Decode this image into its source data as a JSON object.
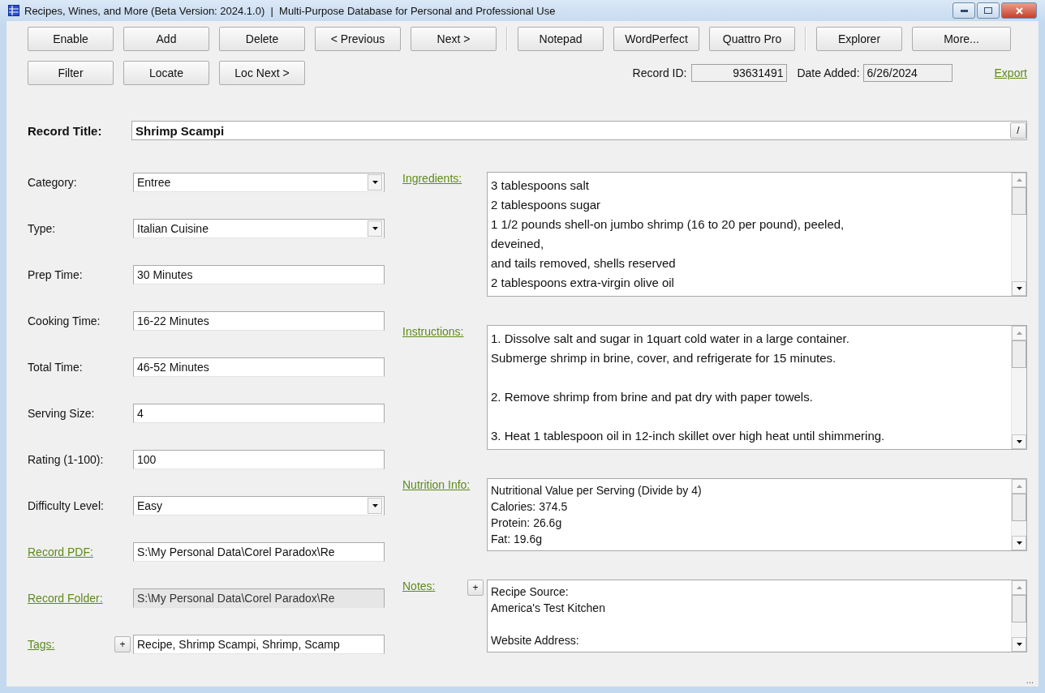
{
  "window": {
    "title": "Recipes, Wines, and More (Beta Version: 2024.1.0)  |  Multi-Purpose Database for Personal and Professional Use"
  },
  "toolbar": {
    "groups": [
      [
        "Enable",
        "Add",
        "Delete",
        "< Previous",
        "Next >"
      ],
      [
        "Notepad",
        "WordPerfect",
        "Quattro Pro"
      ],
      [
        "Explorer",
        "More..."
      ]
    ],
    "second_row": [
      "Filter",
      "Locate",
      "Loc Next >"
    ]
  },
  "record_info": {
    "record_id_label": "Record ID:",
    "record_id": "93631491",
    "date_added_label": "Date Added:",
    "date_added": "6/26/2024",
    "export_link": "Export"
  },
  "record_title": {
    "label": "Record Title:",
    "value": "Shrimp Scampi",
    "button": "/"
  },
  "fields": [
    {
      "label": "Category:",
      "value": "Entree",
      "kind": "dropdown",
      "link": false,
      "disabled": false
    },
    {
      "label": "Type:",
      "value": "Italian Cuisine",
      "kind": "dropdown",
      "link": false,
      "disabled": false
    },
    {
      "label": "Prep Time:",
      "value": "30 Minutes",
      "kind": "text",
      "link": false,
      "disabled": false
    },
    {
      "label": "Cooking Time:",
      "value": "16-22 Minutes",
      "kind": "text",
      "link": false,
      "disabled": false
    },
    {
      "label": "Total Time:",
      "value": "46-52 Minutes",
      "kind": "text",
      "link": false,
      "disabled": false
    },
    {
      "label": "Serving Size:",
      "value": "4",
      "kind": "text",
      "link": false,
      "disabled": false
    },
    {
      "label": "Rating (1-100):",
      "value": "100",
      "kind": "text",
      "link": false,
      "disabled": false
    },
    {
      "label": "Difficulty Level:",
      "value": "Easy",
      "kind": "dropdown",
      "link": false,
      "disabled": false
    },
    {
      "label": "Record PDF:",
      "value": "S:\\My Personal Data\\Corel Paradox\\Re",
      "kind": "text",
      "link": true,
      "disabled": false
    },
    {
      "label": "Record Folder:",
      "value": "S:\\My Personal Data\\Corel Paradox\\Re",
      "kind": "text",
      "link": true,
      "disabled": true
    },
    {
      "label": "Tags:",
      "value": "Recipe, Shrimp Scampi, Shrimp, Scamp",
      "kind": "tags",
      "link": true,
      "disabled": false,
      "add_button": "+"
    }
  ],
  "memos": [
    {
      "label": "Ingredients:",
      "kind": "rich",
      "paragraphs": [
        [
          "3 tablespoons salt",
          "2 tablespoons sugar",
          "1 1/2 pounds shell-on jumbo shrimp (16 to 20 per pound), peeled,",
          "deveined,",
          "and tails removed, shells reserved",
          "2 tablespoons extra-virgin olive oil"
        ]
      ]
    },
    {
      "label": "Instructions:",
      "kind": "rich",
      "paragraphs": [
        [
          "1. Dissolve salt and sugar in 1quart cold water in a large container.",
          "Submerge shrimp in brine, cover, and refrigerate for 15 minutes."
        ],
        [
          "2. Remove shrimp from brine and pat dry with paper towels."
        ],
        [
          "3. Heat 1 tablespoon oil in 12-inch skillet over high heat until shimmering."
        ]
      ]
    },
    {
      "label": "Nutrition Info:",
      "kind": "plain",
      "paragraphs": [
        [
          "Nutritional Value per Serving (Divide by 4)",
          "Calories: 374.5",
          "Protein: 26.6g",
          "Fat: 19.6g"
        ]
      ]
    },
    {
      "label": "Notes:",
      "kind": "plain",
      "add_button": "+",
      "paragraphs": [
        [
          "Recipe Source:",
          "America's Test Kitchen"
        ],
        [
          "Website Address:"
        ]
      ]
    }
  ],
  "status_bar": {
    "grip": "..."
  }
}
